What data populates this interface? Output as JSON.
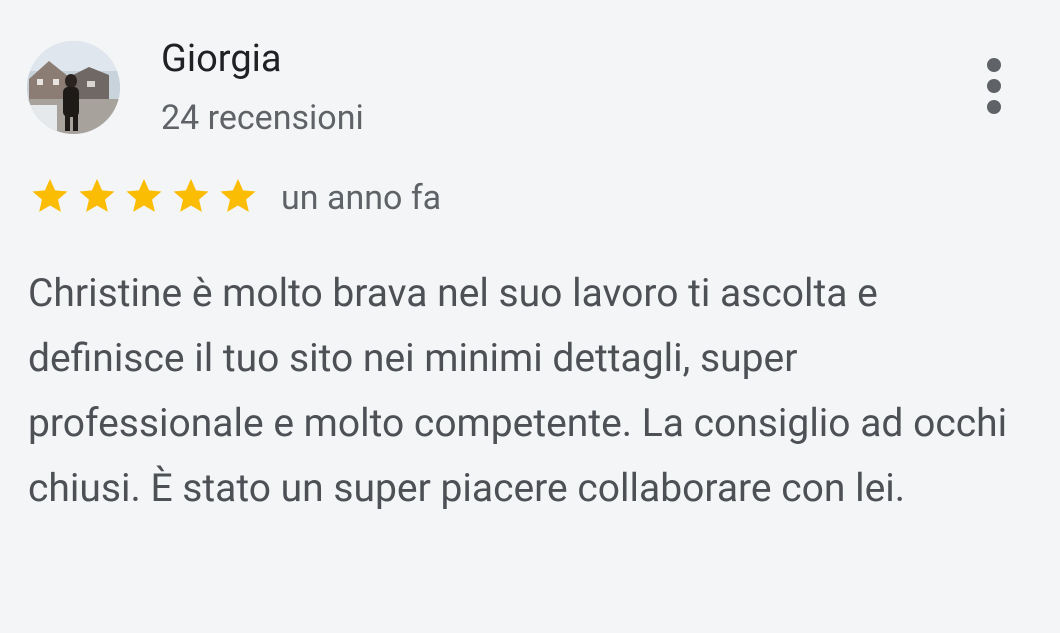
{
  "review": {
    "author_name": "Giorgia",
    "review_count": "24 recensioni",
    "rating": 5,
    "rating_max": 5,
    "date": "un anno fa",
    "text": "Christine è molto brava nel suo lavoro ti ascolta e definisce il tuo sito nei minimi dettagli, super professionale e molto competente. La consiglio ad occhi chiusi. È stato un super piacere collaborare con lei."
  },
  "icons": {
    "star": "star-icon",
    "more": "more-vert-icon",
    "avatar": "user-avatar"
  },
  "colors": {
    "background": "#f4f5f7",
    "star": "#fbbc04",
    "name_text": "#202124",
    "secondary_text": "#5f6368",
    "body_text": "#4d5156"
  }
}
